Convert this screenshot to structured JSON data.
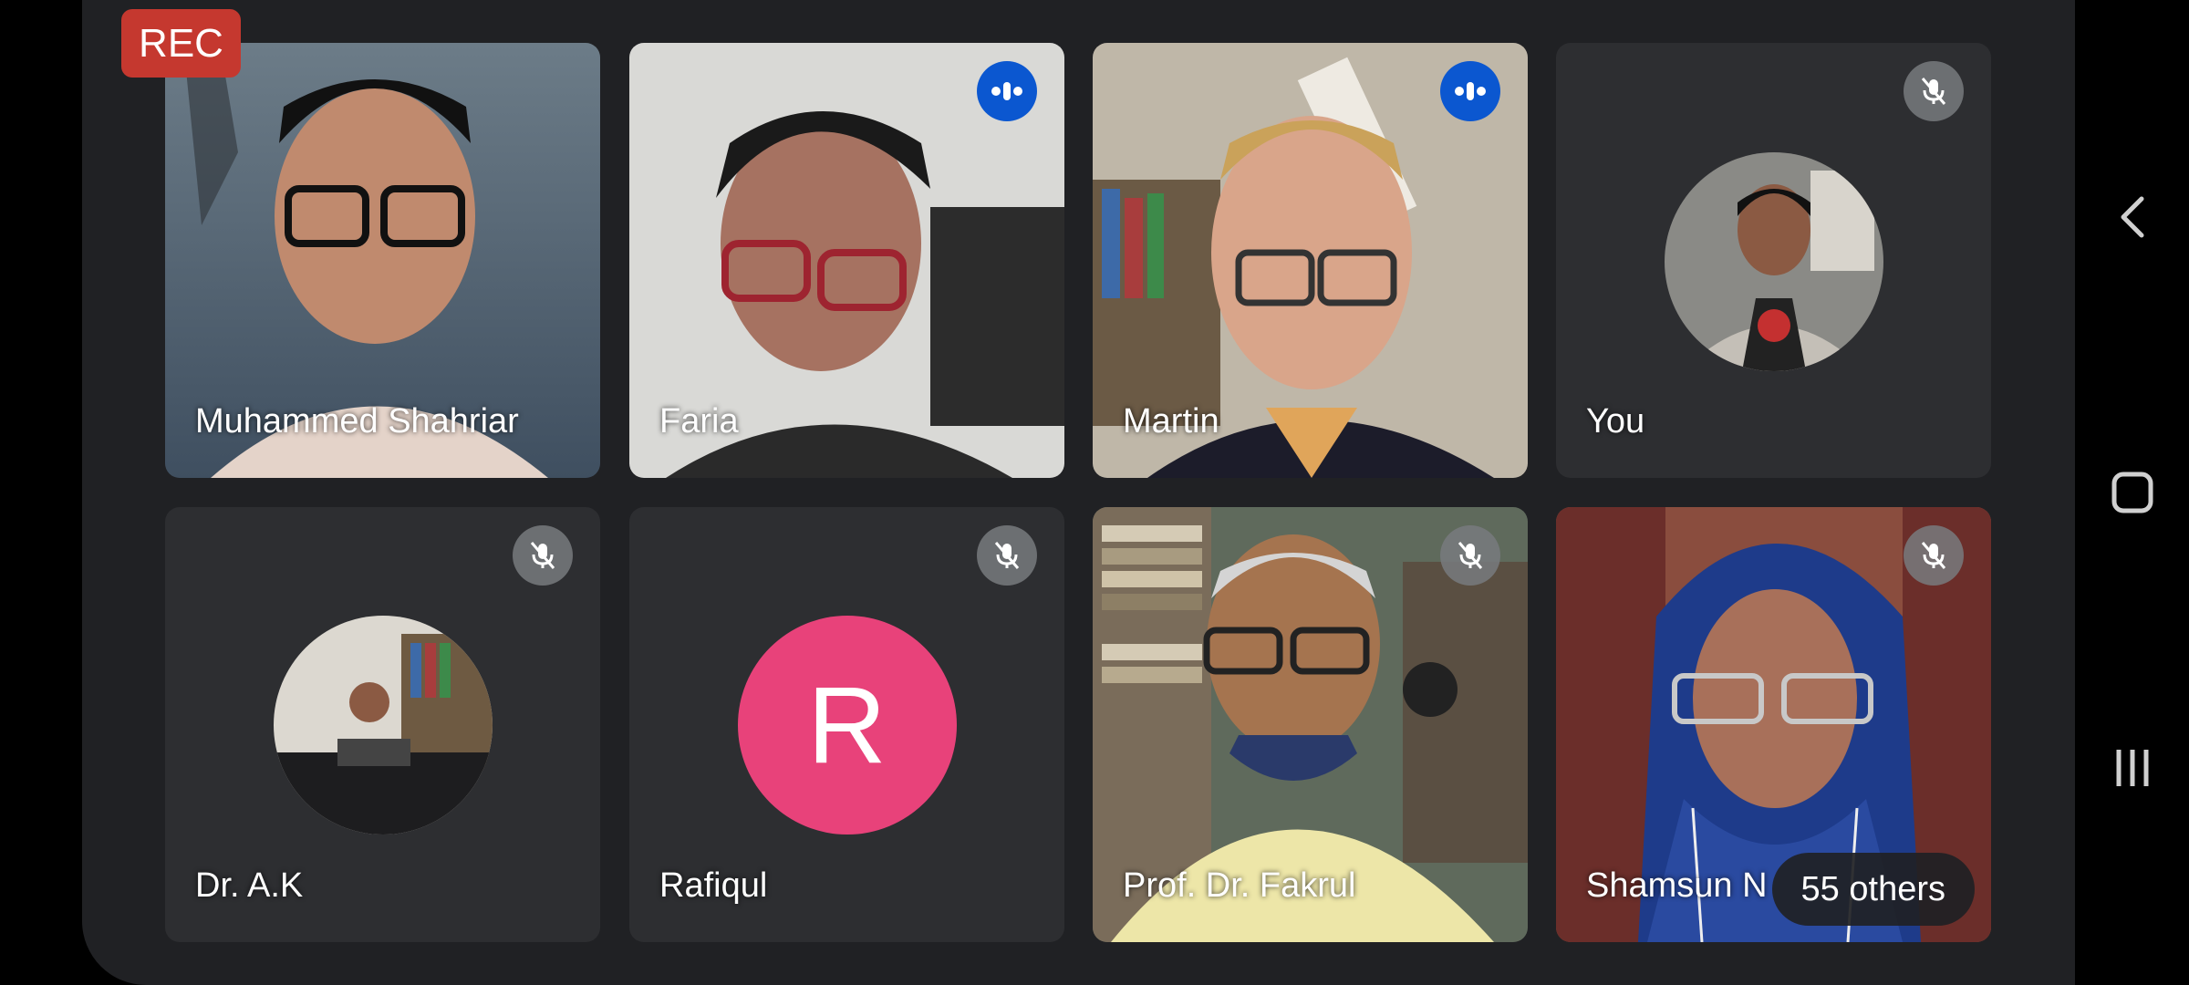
{
  "recording": {
    "label": "REC"
  },
  "participants": [
    {
      "name": "Muhammed Shahriar",
      "status": "video"
    },
    {
      "name": "Faria",
      "status": "speaking"
    },
    {
      "name": "Martin",
      "status": "speaking"
    },
    {
      "name": "You",
      "status": "muted"
    },
    {
      "name": "Dr. A.K",
      "status": "muted"
    },
    {
      "name": "Rafiqul",
      "status": "muted",
      "initial": "R"
    },
    {
      "name": "Prof. Dr. Fakrul",
      "status": "muted"
    },
    {
      "name": "Shamsun N",
      "status": "muted"
    }
  ],
  "overflow": {
    "label": "55 others"
  },
  "colors": {
    "stage": "#202124",
    "tile": "#2d2e31",
    "speaking": "#0b57d0",
    "rec": "#c5382f",
    "avatar_r": "#e8427a"
  },
  "system_nav": {
    "back": "chevron-left-icon",
    "home": "square-home-icon",
    "recents": "recents-icon"
  }
}
